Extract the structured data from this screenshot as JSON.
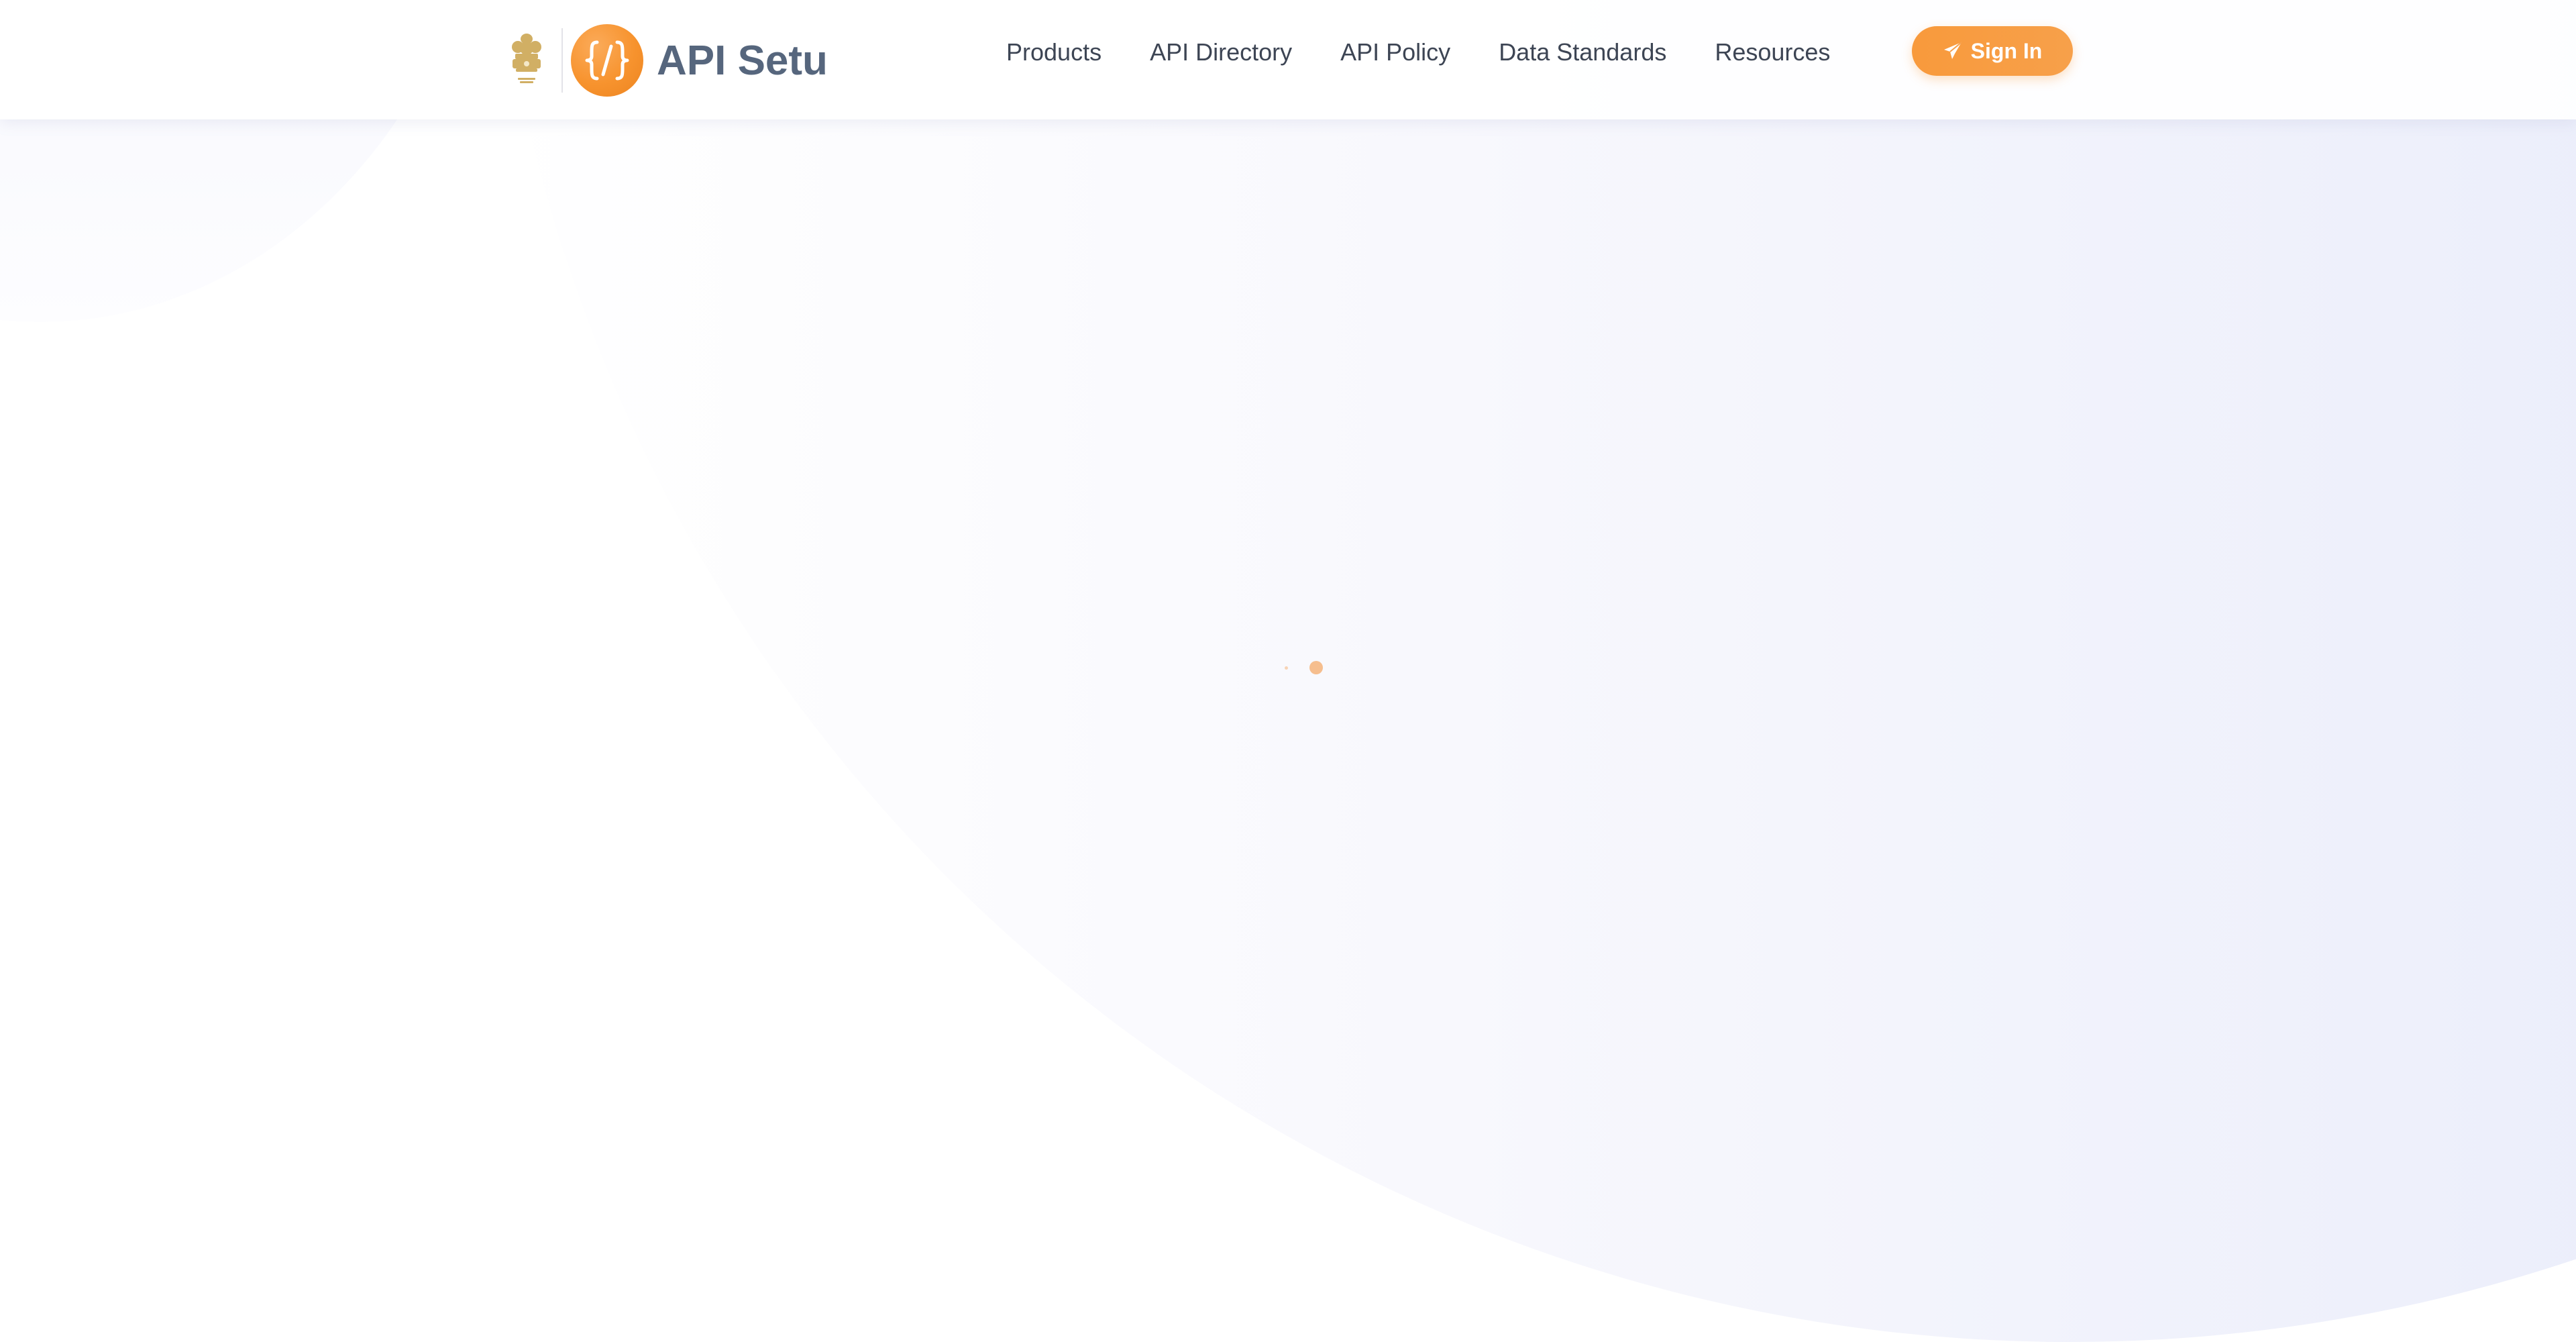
{
  "brand": {
    "name": "API Setu",
    "emblem_icon": "state-emblem-icon",
    "logo_icon": "code-braces-icon",
    "accent_color": "#F7932E"
  },
  "nav": {
    "items": [
      {
        "label": "Products"
      },
      {
        "label": "API Directory"
      },
      {
        "label": "API Policy"
      },
      {
        "label": "Data Standards"
      },
      {
        "label": "Resources"
      }
    ]
  },
  "header": {
    "signin_label": "Sign In",
    "signin_icon": "paper-plane-icon"
  },
  "loader": {
    "icon": "loading-dots-icon",
    "color": "#F6B47A"
  }
}
